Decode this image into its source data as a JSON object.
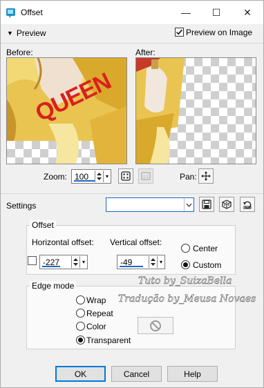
{
  "window": {
    "title": "Offset",
    "minimize_glyph": "—",
    "maximize_glyph": "☐",
    "close_glyph": "✕"
  },
  "preview": {
    "toggle_label": "Preview",
    "preview_on_image_label": "Preview on Image",
    "preview_on_image_checked": true,
    "before_label": "Before:",
    "after_label": "After:",
    "zoom_label": "Zoom:",
    "zoom_value": "100",
    "pan_label": "Pan:",
    "necklace_text": "QUEEN"
  },
  "settings": {
    "label": "Settings",
    "preset_value": ""
  },
  "offset": {
    "group_label": "Offset",
    "horizontal_label": "Horizontal offset:",
    "horizontal_value": "-227",
    "vertical_label": "Vertical offset:",
    "vertical_value": "-49",
    "link_checked": false,
    "center_label": "Center",
    "custom_label": "Custom",
    "selected": "custom"
  },
  "edge_mode": {
    "group_label": "Edge mode",
    "options": [
      "Wrap",
      "Repeat",
      "Color",
      "Transparent"
    ],
    "selected": "Transparent"
  },
  "buttons": {
    "ok": "OK",
    "cancel": "Cancel",
    "help": "Help"
  },
  "watermark": {
    "line1": "Tuto by_SuizaBella",
    "line2": "Tradução by_Meusa Novaes"
  },
  "colors": {
    "accent": "#1a65c8",
    "default_button_border": "#0078d7",
    "necklace_red": "#d9201f",
    "coat_yellow": "#e7bf3c"
  }
}
